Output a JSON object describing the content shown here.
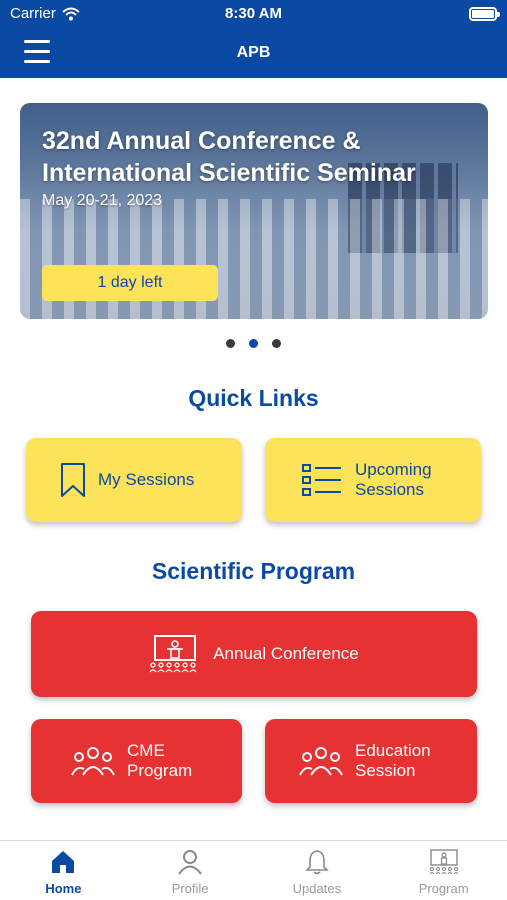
{
  "status": {
    "carrier": "Carrier",
    "time": "8:30 AM"
  },
  "nav": {
    "title": "APB"
  },
  "banner": {
    "line1": "32nd Annual Conference &",
    "line2": "International Scientific Seminar",
    "date": "May 20-21, 2023",
    "countdown": "1 day left",
    "active_slide": 2,
    "slide_count": 3
  },
  "quick_links": {
    "title": "Quick Links",
    "my_sessions": "My Sessions",
    "upcoming_line1": "Upcoming",
    "upcoming_line2": "Sessions"
  },
  "program": {
    "title": "Scientific Program",
    "annual": "Annual Conference",
    "cme_line1": "CME",
    "cme_line2": "Program",
    "edu_line1": "Education",
    "edu_line2": "Session"
  },
  "tabs": [
    {
      "label": "Home",
      "icon": "home-icon"
    },
    {
      "label": "Profile",
      "icon": "profile-icon"
    },
    {
      "label": "Updates",
      "icon": "bell-icon"
    },
    {
      "label": "Program",
      "icon": "podium-icon"
    }
  ],
  "colors": {
    "primary": "#0b4aa2",
    "yellow": "#fde35a",
    "red": "#e63232"
  }
}
